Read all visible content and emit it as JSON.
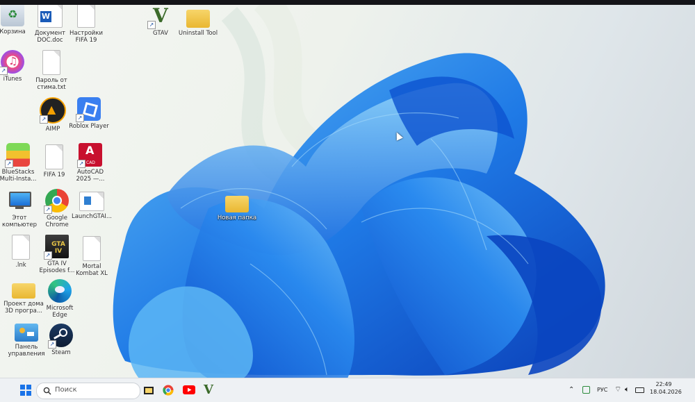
{
  "desktop": {
    "icons": [
      {
        "label": "Корзина",
        "icon": "recycle-bin-icon"
      },
      {
        "label": "Документ\nDOC.doc",
        "icon": "word-document-icon"
      },
      {
        "label": "Настройки\nFIFA 19",
        "icon": "text-file-icon"
      },
      {
        "label": "GTAV",
        "icon": "gta-v-icon"
      },
      {
        "label": "Uninstall Tool",
        "icon": "folder-icon"
      },
      {
        "label": "iTunes",
        "icon": "itunes-icon"
      },
      {
        "label": "Пароль от\nстима.txt",
        "icon": "text-file-icon"
      },
      {
        "label": "AIMP",
        "icon": "aimp-icon"
      },
      {
        "label": "Roblox Player",
        "icon": "roblox-icon"
      },
      {
        "label": "BlueStacks\nMulti-Insta...",
        "icon": "bluestacks-icon"
      },
      {
        "label": "FIFA 19",
        "icon": "text-file-icon"
      },
      {
        "label": "AutoCAD\n2025 —...",
        "icon": "autocad-icon"
      },
      {
        "label": "Этот\nкомпьютер",
        "icon": "monitor-icon"
      },
      {
        "label": "Google\nChrome",
        "icon": "chrome-icon"
      },
      {
        "label": "LaunchGTAI...",
        "icon": "launcher-icon"
      },
      {
        "label": "Новая папка",
        "icon": "folder-icon"
      },
      {
        "label": ".lnk",
        "icon": "text-file-icon"
      },
      {
        "label": "GTA IV\nEpisodes f...",
        "icon": "gta-iv-icon"
      },
      {
        "label": "Mortal\nKombat XL",
        "icon": "text-file-icon"
      },
      {
        "label": "Проект дома\n3D програ...",
        "icon": "folder-icon"
      },
      {
        "label": "Microsoft\nEdge",
        "icon": "edge-icon"
      },
      {
        "label": "Панель\nуправления",
        "icon": "control-panel-icon"
      },
      {
        "label": "Steam",
        "icon": "steam-icon"
      }
    ]
  },
  "taskbar": {
    "search_placeholder": "Поиск",
    "apps": [
      "start-icon",
      "file-explorer-icon",
      "chrome-icon",
      "youtube-icon",
      "gta-v-icon"
    ],
    "language": "РУС",
    "time": "22:49",
    "date": "18.04.2026"
  },
  "colors": {
    "accent": "#1a73e8",
    "bloom_dark": "#0a3fb8",
    "bloom_light": "#3fa0ef",
    "taskbar_bg": "#eef1f4"
  }
}
